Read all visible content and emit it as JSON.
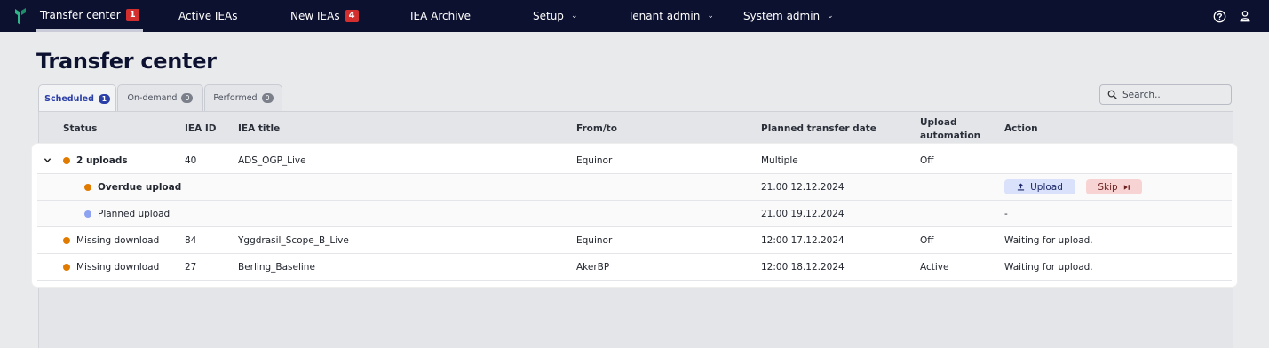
{
  "nav": {
    "items": [
      {
        "label": "Transfer center",
        "badge": "1"
      },
      {
        "label": "Active IEAs"
      },
      {
        "label": "New IEAs",
        "badge": "4"
      },
      {
        "label": "IEA Archive"
      },
      {
        "label": "Setup"
      },
      {
        "label": "Tenant admin"
      },
      {
        "label": "System admin"
      }
    ]
  },
  "page": {
    "title": "Transfer center"
  },
  "tabs": [
    {
      "label": "Scheduled",
      "count": "1"
    },
    {
      "label": "On-demand",
      "count": "0"
    },
    {
      "label": "Performed",
      "count": "0"
    }
  ],
  "search": {
    "placeholder": "Search.."
  },
  "table": {
    "columns": [
      "Status",
      "IEA ID",
      "IEA title",
      "From/to",
      "Planned transfer date",
      "Upload automation",
      "Action"
    ],
    "rows": [
      {
        "status": "2 uploads",
        "iea_id": "40",
        "iea_title": "ADS_OGP_Live",
        "from_to": "Equinor",
        "date": "Multiple",
        "automation": "Off",
        "action": ""
      },
      {
        "status": "Overdue upload",
        "date": "21.00 12.12.2024",
        "upload_label": "Upload",
        "skip_label": "Skip"
      },
      {
        "status": "Planned upload",
        "date": "21.00 19.12.2024",
        "action": "-"
      },
      {
        "status": "Missing download",
        "iea_id": "84",
        "iea_title": "Yggdrasil_Scope_B_Live",
        "from_to": "Equinor",
        "date": "12:00 17.12.2024",
        "automation": "Off",
        "action": "Waiting for upload."
      },
      {
        "status": "Missing download",
        "iea_id": "27",
        "iea_title": "Berling_Baseline",
        "from_to": "AkerBP",
        "date": "12:00 18.12.2024",
        "automation": "Active",
        "action": "Waiting for upload."
      }
    ]
  },
  "icons": {
    "help": "help-circle-icon",
    "user": "user-icon",
    "search": "search-icon",
    "expand": "chevron-down-icon",
    "upload": "upload-icon",
    "skip": "skip-forward-icon"
  },
  "colors": {
    "nav_bg": "#0d1130",
    "badge_red": "#d32f2f",
    "status_orange": "#e07b00",
    "status_blue": "#8ea2f2",
    "tab_active": "#2b3fa8",
    "upload_btn": "#d9e1fb",
    "skip_btn": "#f8d3d3"
  }
}
